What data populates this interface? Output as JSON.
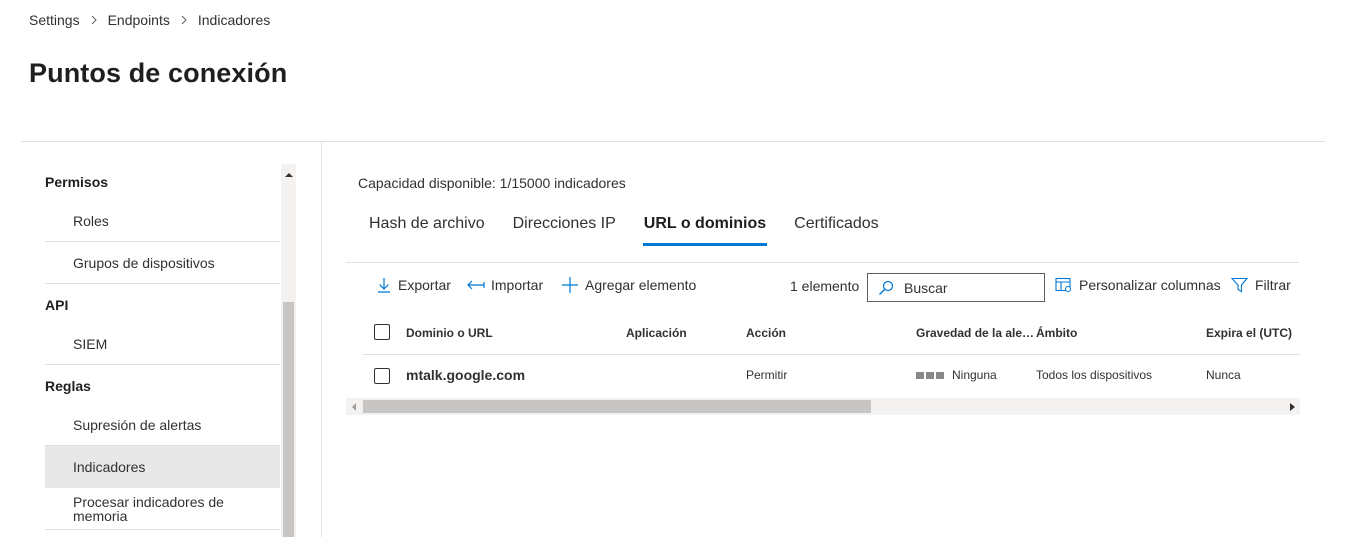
{
  "breadcrumb": [
    "Settings",
    "Endpoints",
    "Indicadores"
  ],
  "page_title": "Puntos de conexión",
  "sidebar": {
    "sections": [
      {
        "heading": "Permisos",
        "items": [
          "Roles",
          "Grupos de dispositivos"
        ]
      },
      {
        "heading": "API",
        "items": [
          "SIEM"
        ]
      },
      {
        "heading": "Reglas",
        "items": [
          "Supresión de alertas",
          "Indicadores",
          "Procesar indicadores de memoria"
        ]
      }
    ],
    "active_item": "Indicadores"
  },
  "capacity_text": "Capacidad disponible: 1/15000 indicadores",
  "tabs": [
    "Hash de archivo",
    "Direcciones IP",
    "URL o dominios",
    "Certificados"
  ],
  "active_tab": "URL o dominios",
  "toolbar": {
    "export_label": "Exportar",
    "import_label": "Importar",
    "add_label": "Agregar elemento",
    "count_label": "1 elemento",
    "search_placeholder": "Buscar",
    "customize_label": "Personalizar columnas",
    "filter_label": "Filtrar"
  },
  "table": {
    "columns": [
      "Dominio o URL",
      "Aplicación",
      "Acción",
      "Gravedad de la ale…",
      "Ámbito",
      "Expira el (UTC)"
    ],
    "rows": [
      {
        "domain": "mtalk.google.com",
        "application": "",
        "action": "Permitir",
        "severity": "Ninguna",
        "scope": "Todos los dispositivos",
        "expires": "Nunca"
      }
    ]
  },
  "colors": {
    "accent": "#0078d4",
    "active_bg": "#e8e8e8",
    "divider": "#e1dfdd"
  }
}
